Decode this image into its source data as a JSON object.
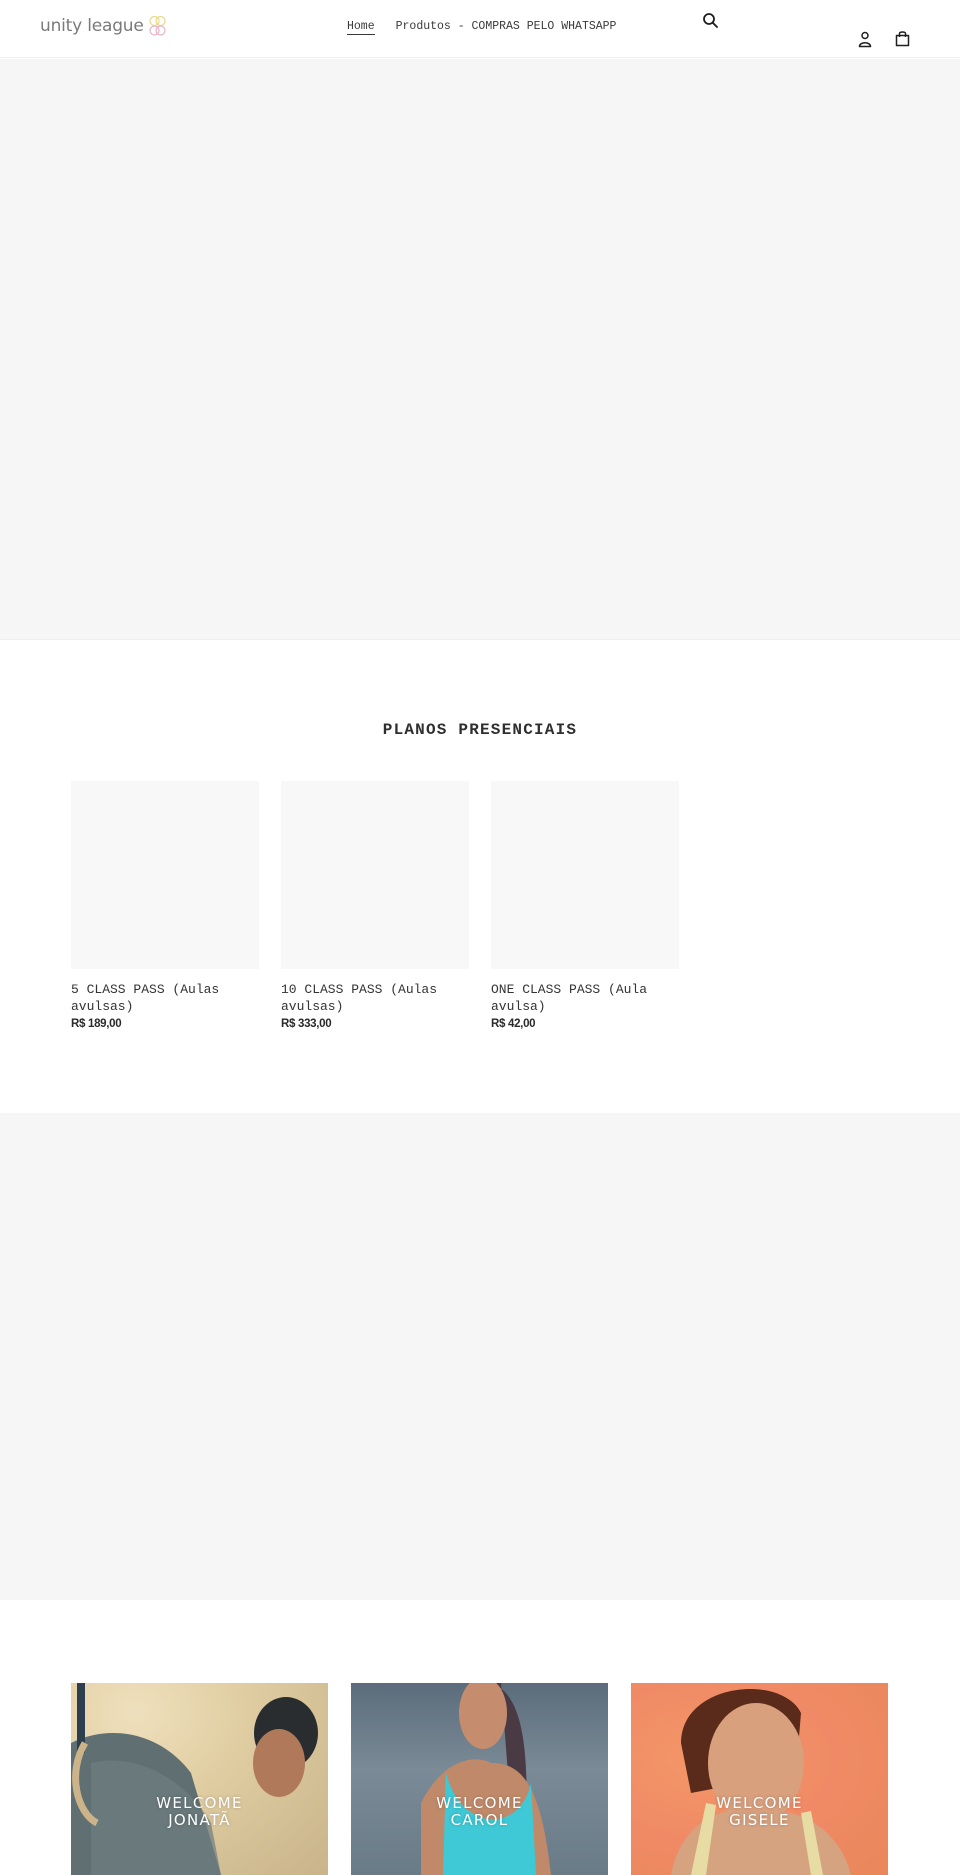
{
  "header": {
    "logo_text": "unity league",
    "logo_colors": {
      "top_rings": "#e9d98c",
      "bottom_rings": "#e6b3c4"
    },
    "nav": [
      {
        "label": "Home",
        "active": true
      },
      {
        "label": "Produtos - COMPRAS PELO WHATSAPP",
        "active": false
      }
    ],
    "icons": {
      "search": "search-icon",
      "account": "account-icon",
      "cart": "cart-icon"
    }
  },
  "collection": {
    "title": "PLANOS PRESENCIAIS",
    "products": [
      {
        "title": "5 CLASS PASS (Aulas avulsas)",
        "price": "R$ 189,00"
      },
      {
        "title": "10 CLASS PASS (Aulas avulsas)",
        "price": "R$ 333,00"
      },
      {
        "title": "ONE CLASS PASS (Aula avulsa)",
        "price": "R$ 42,00"
      }
    ]
  },
  "gallery": {
    "tiles": [
      {
        "line1": "WELCOME",
        "line2": "JONATÃ"
      },
      {
        "line1": "WELCOME",
        "line2": "CAROL"
      },
      {
        "line1": "WELCOME",
        "line2": "GISELE"
      }
    ]
  }
}
